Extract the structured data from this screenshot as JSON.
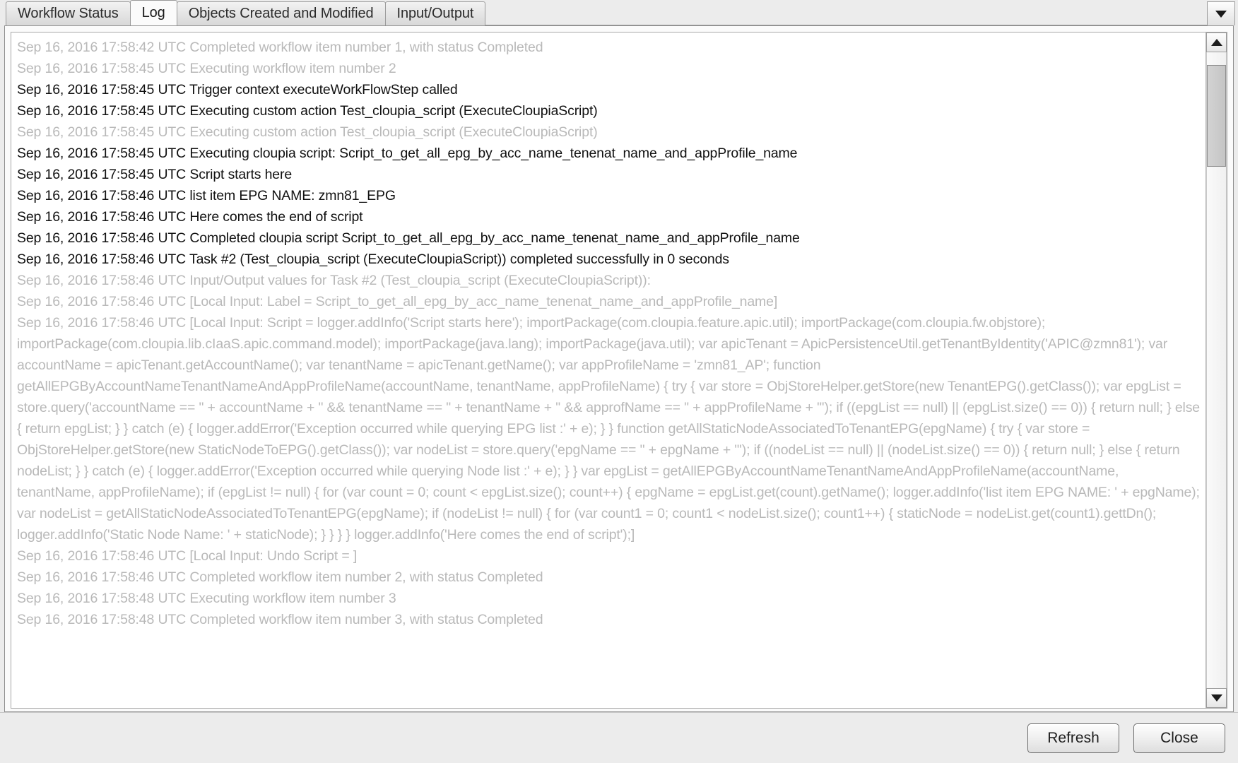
{
  "window": {
    "tabs": [
      {
        "label": "Workflow Status",
        "active": false
      },
      {
        "label": "Log",
        "active": true
      },
      {
        "label": "Objects Created and Modified",
        "active": false
      },
      {
        "label": "Input/Output",
        "active": false
      }
    ],
    "tab_overflow_icon": "chevron-down-icon"
  },
  "log": {
    "lines": [
      {
        "text": "Sep 16, 2016 17:58:42 UTC Completed workflow item number 1, with status Completed",
        "muted": true
      },
      {
        "text": "Sep 16, 2016 17:58:45 UTC Executing workflow item number 2",
        "muted": true
      },
      {
        "text": "Sep 16, 2016 17:58:45 UTC Trigger context executeWorkFlowStep called",
        "muted": false
      },
      {
        "text": "Sep 16, 2016 17:58:45 UTC Executing custom action Test_cloupia_script (ExecuteCloupiaScript)",
        "muted": false
      },
      {
        "text": "Sep 16, 2016 17:58:45 UTC Executing custom action Test_cloupia_script (ExecuteCloupiaScript)",
        "muted": true
      },
      {
        "text": "Sep 16, 2016 17:58:45 UTC Executing cloupia script: Script_to_get_all_epg_by_acc_name_tenenat_name_and_appProfile_name",
        "muted": false
      },
      {
        "text": "Sep 16, 2016 17:58:45 UTC Script starts here",
        "muted": false
      },
      {
        "text": "Sep 16, 2016 17:58:46 UTC list item EPG NAME: zmn81_EPG",
        "muted": false
      },
      {
        "text": "Sep 16, 2016 17:58:46 UTC Here comes the end of script",
        "muted": false
      },
      {
        "text": "Sep 16, 2016 17:58:46 UTC Completed cloupia script Script_to_get_all_epg_by_acc_name_tenenat_name_and_appProfile_name",
        "muted": false
      },
      {
        "text": "Sep 16, 2016 17:58:46 UTC Task #2 (Test_cloupia_script (ExecuteCloupiaScript)) completed successfully in 0 seconds",
        "muted": false
      },
      {
        "text": "Sep 16, 2016 17:58:46 UTC Input/Output values for Task #2 (Test_cloupia_script (ExecuteCloupiaScript)):",
        "muted": true
      },
      {
        "text": "Sep 16, 2016 17:58:46 UTC [Local Input: Label = Script_to_get_all_epg_by_acc_name_tenenat_name_and_appProfile_name]",
        "muted": true
      },
      {
        "text": "Sep 16, 2016 17:58:46 UTC [Local Input: Script = logger.addInfo('Script starts here'); importPackage(com.cloupia.feature.apic.util); importPackage(com.cloupia.fw.objstore); importPackage(com.cloupia.lib.cIaaS.apic.command.model); importPackage(java.lang); importPackage(java.util); var apicTenant = ApicPersistenceUtil.getTenantByIdentity('APIC@zmn81'); var accountName = apicTenant.getAccountName(); var tenantName = apicTenant.getName(); var appProfileName = 'zmn81_AP'; function getAllEPGByAccountNameTenantNameAndAppProfileName(accountName, tenantName, appProfileName) { try { var store = ObjStoreHelper.getStore(new TenantEPG().getClass()); var epgList = store.query('accountName == \" + accountName + \" && tenantName == \" + tenantName + \" && approfName == \" + appProfileName + \"'); if ((epgList == null) || (epgList.size() == 0)) { return null; } else { return epgList; } } catch (e) { logger.addError('Exception occurred while querying EPG list :' + e); } } function getAllStaticNodeAssociatedToTenantEPG(epgName) { try { var store = ObjStoreHelper.getStore(new StaticNodeToEPG().getClass()); var nodeList = store.query('epgName == \" + epgName + \"'); if ((nodeList == null) || (nodeList.size() == 0)) { return null; } else { return nodeList; } } catch (e) { logger.addError('Exception occurred while querying Node list :' + e); } } var epgList = getAllEPGByAccountNameTenantNameAndAppProfileName(accountName, tenantName, appProfileName); if (epgList != null) { for (var count = 0; count < epgList.size(); count++) { epgName = epgList.get(count).getName(); logger.addInfo('list item EPG NAME: ' + epgName); var nodeList = getAllStaticNodeAssociatedToTenantEPG(epgName); if (nodeList != null) { for (var count1 = 0; count1 < nodeList.size(); count1++) { staticNode = nodeList.get(count1).gettDn(); logger.addInfo('Static Node Name: ' + staticNode); } } } } logger.addInfo('Here comes the end of script');]",
        "muted": true
      },
      {
        "text": "Sep 16, 2016 17:58:46 UTC [Local Input: Undo Script = ]",
        "muted": true
      },
      {
        "text": "Sep 16, 2016 17:58:46 UTC Completed workflow item number 2, with status Completed",
        "muted": true
      },
      {
        "text": "Sep 16, 2016 17:58:48 UTC Executing workflow item number 3",
        "muted": true
      },
      {
        "text": "Sep 16, 2016 17:58:48 UTC Completed workflow item number 3, with status Completed",
        "muted": true
      }
    ]
  },
  "scrollbar": {
    "up_icon": "arrow-up-icon",
    "down_icon": "arrow-down-icon",
    "thumb_top_pct": "2%",
    "thumb_height_pct": "16%"
  },
  "footer": {
    "refresh_label": "Refresh",
    "close_label": "Close"
  }
}
